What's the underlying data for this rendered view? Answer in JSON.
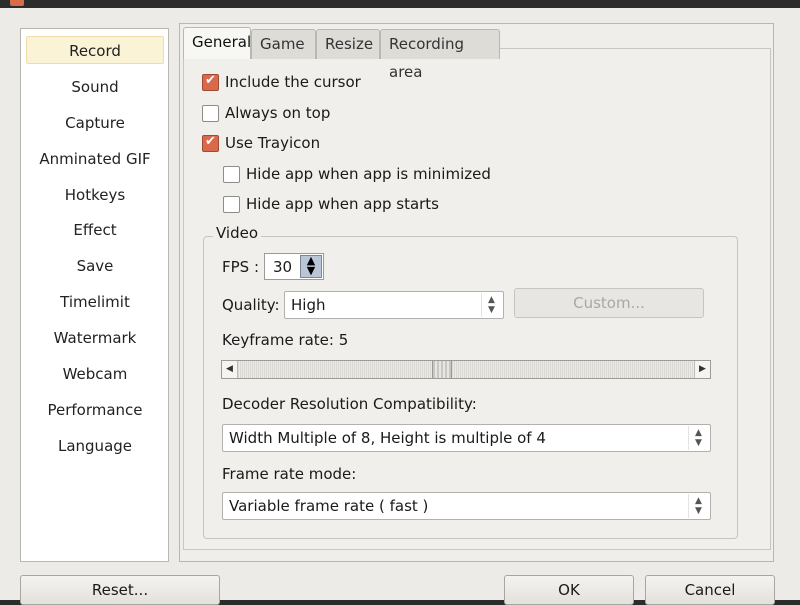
{
  "sidebar": {
    "items": [
      {
        "label": "Record",
        "selected": true
      },
      {
        "label": "Sound"
      },
      {
        "label": "Capture"
      },
      {
        "label": "Anminated GIF"
      },
      {
        "label": "Hotkeys"
      },
      {
        "label": "Effect"
      },
      {
        "label": "Save"
      },
      {
        "label": "Timelimit"
      },
      {
        "label": "Watermark"
      },
      {
        "label": "Webcam"
      },
      {
        "label": "Performance"
      },
      {
        "label": "Language"
      }
    ]
  },
  "tabs": [
    {
      "label": "General",
      "active": true
    },
    {
      "label": "Game"
    },
    {
      "label": "Resize"
    },
    {
      "label": "Recording area"
    }
  ],
  "general": {
    "include_cursor": {
      "label": "Include the cursor",
      "checked": true
    },
    "always_on_top": {
      "label": "Always on top",
      "checked": false
    },
    "use_trayicon": {
      "label": "Use Trayicon",
      "checked": true
    },
    "hide_minimized": {
      "label": "Hide app when app is minimized",
      "checked": false
    },
    "hide_starts": {
      "label": "Hide app when app starts",
      "checked": false
    }
  },
  "video": {
    "group_title": "Video",
    "fps_label": "FPS :",
    "fps_value": "30",
    "quality_label": "Quality:",
    "quality_value": "High",
    "custom_button": "Custom...",
    "keyframe_label": "Keyframe rate: 5",
    "decoder_label": "Decoder Resolution Compatibility:",
    "decoder_value": "Width Multiple of 8, Height is multiple of 4",
    "frame_rate_label": "Frame rate mode:",
    "frame_rate_value": "Variable frame rate ( fast )"
  },
  "footer": {
    "reset": "Reset...",
    "ok": "OK",
    "cancel": "Cancel"
  },
  "colors": {
    "checkbox_checked": "#d9694b",
    "selected_item": "#fbf3d6",
    "window_bg": "#ecebe7"
  }
}
